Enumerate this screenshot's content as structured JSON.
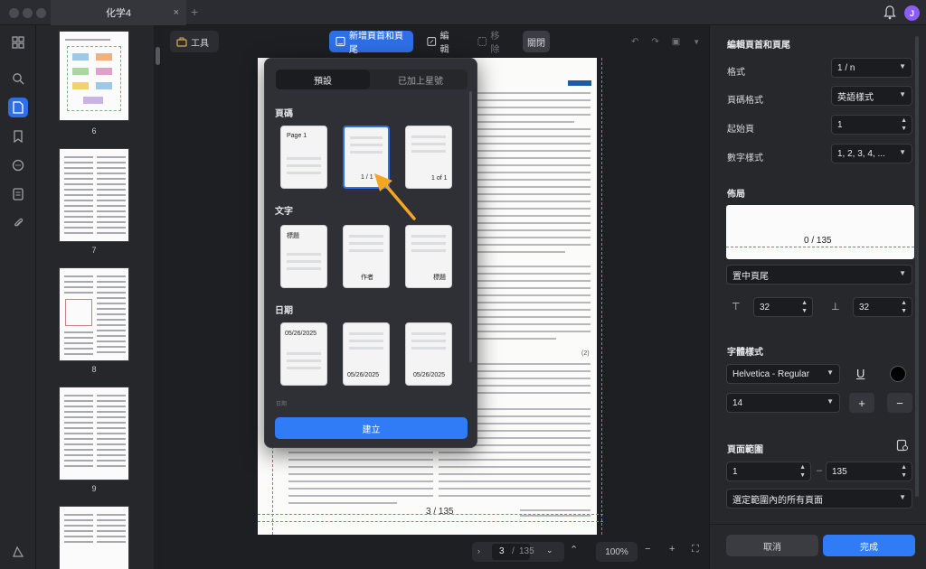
{
  "window": {
    "tab_title": "化学4",
    "tab_close": "×",
    "tab_add": "+",
    "avatar_initial": "J",
    "avatar_color": "#8b5cf6"
  },
  "thumbnails": [
    {
      "num": "6"
    },
    {
      "num": "7"
    },
    {
      "num": "8"
    },
    {
      "num": "9"
    }
  ],
  "toolbar": {
    "tools": "工具",
    "add_header_footer": "新增頁首和頁尾",
    "edit": "編輯",
    "remove": "移除",
    "close": "關閉"
  },
  "popover": {
    "tab_preset": "預設",
    "tab_starred": "已加上星號",
    "section_page": "頁碼",
    "section_text": "文字",
    "section_date": "日期",
    "page_tpl": [
      "Page 1",
      "1 / 1",
      "1 of 1"
    ],
    "text_tpl": [
      "標題",
      "作者",
      "標題"
    ],
    "date_tpl": [
      "05/26/2025",
      "05/26/2025",
      "05/26/2025"
    ],
    "next_section": "日期",
    "create": "建立"
  },
  "document": {
    "footer_text": "3 / 135",
    "equation_no": "(2)"
  },
  "nav": {
    "current_page": "3",
    "separator": "/",
    "total_pages": "135",
    "zoom": "100%"
  },
  "panel": {
    "title": "編輯頁首和頁尾",
    "format_label": "格式",
    "format_value": "1 / n",
    "page_format_label": "頁碼格式",
    "page_format_value": "英語樣式",
    "start_page_label": "起始頁",
    "start_page_value": "1",
    "number_style_label": "數字樣式",
    "number_style_value": "1, 2, 3, 4, ...",
    "layout_title": "佈局",
    "preview_text": "0 / 135",
    "position_value": "置中頁尾",
    "margin_top": "32",
    "margin_bottom": "32",
    "font_title": "字體樣式",
    "font_value": "Helvetica - Regular",
    "underline": "U",
    "font_size": "14",
    "plus": "+",
    "minus": "−",
    "range_title": "頁面範圍",
    "range_from": "1",
    "range_dash": "–",
    "range_to": "135",
    "range_scope": "選定範圍內的所有頁面",
    "cancel": "取消",
    "done": "完成",
    "text_color": "#000000"
  }
}
